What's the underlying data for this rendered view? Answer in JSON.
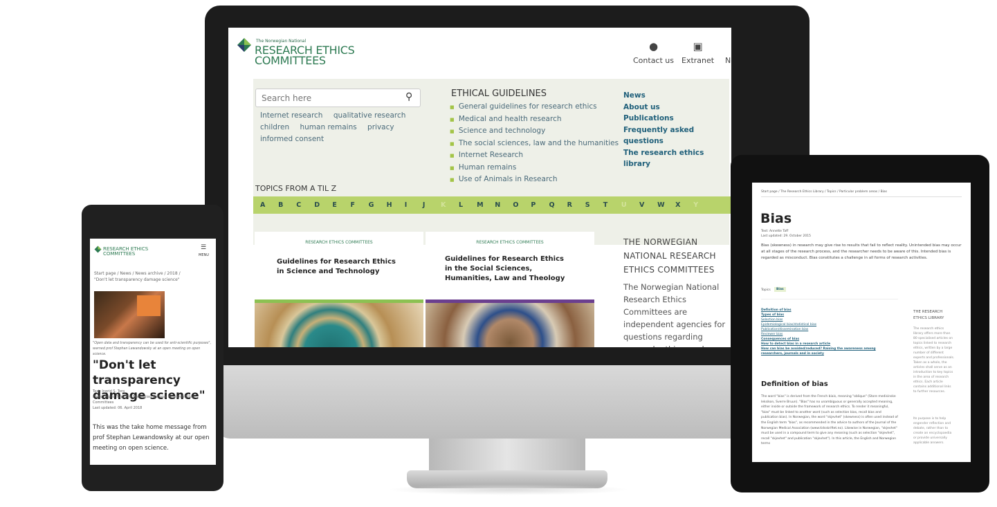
{
  "desktop": {
    "logo": {
      "small": "The Norwegian National",
      "line1": "RESEARCH ETHICS",
      "line2": "COMMITTEES"
    },
    "top_buttons": [
      {
        "label": "Contact us",
        "icon": "chat-icon"
      },
      {
        "label": "Extranet",
        "icon": "lock-icon"
      },
      {
        "label": "Norsk",
        "icon": "globe-icon"
      }
    ],
    "search": {
      "placeholder": "Search here"
    },
    "tags": [
      "Internet research",
      "qualitative research",
      "children",
      "human remains",
      "privacy",
      "informed consent"
    ],
    "ethical_guidelines": {
      "title": "ETHICAL GUIDELINES",
      "items": [
        "General guidelines for research ethics",
        "Medical and health research",
        "Science and technology",
        "The social sciences, law and the humanities",
        "Internet Research",
        "Human remains",
        "Use of Animals in Research"
      ]
    },
    "quick_links": [
      "News",
      "About us",
      "Publications",
      "Frequently asked questions",
      "The research ethics library"
    ],
    "topics": {
      "title": "TOPICS FROM A TIL Z",
      "letters": [
        "A",
        "B",
        "C",
        "D",
        "E",
        "F",
        "G",
        "H",
        "I",
        "J",
        "K",
        "L",
        "M",
        "N",
        "O",
        "P",
        "Q",
        "R",
        "S",
        "T",
        "U",
        "V",
        "W",
        "X",
        "Y"
      ]
    },
    "publications": [
      {
        "logo": "RESEARCH ETHICS COMMITTEES",
        "title_line1": "Guidelines for Research Ethics",
        "title_line2": "in Science and Technology",
        "title_line3": "",
        "bar_color": "#8cc152"
      },
      {
        "logo": "RESEARCH ETHICS COMMITTEES",
        "title_line1": "Guidelines for Research Ethics",
        "title_line2": "in the Social Sciences,",
        "title_line3": "Humanities, Law and Theology",
        "bar_color": "#6b3f8f"
      }
    ],
    "about": {
      "title": "THE NORWEGIAN NATIONAL RESEARCH ETHICS COMMITTEES",
      "body": "The Norwegian National Research Ethics Committees are independent agencies for questions regarding research ethics, and investigating misconduct, within all subject areas."
    }
  },
  "phone": {
    "logo": "RESEARCH ETHICS COMMITTEES",
    "menu_label": "MENU",
    "breadcrumb": "Start page / News / News archive / 2018 /",
    "breadcrumb_current": "\"Don't let transparency damage science\"",
    "caption": "\"Open data and transparency can be used for anti-scientific purposes\", warned prof Stephan Lewandowsky at an open meeting on open science.",
    "title": "\"Don't let transparency damage science\"",
    "meta": [
      "Text: Ingrid S. Torp",
      "Photo: Ingrid Torp/ The Norwegian National Research Ethics Committees",
      "Last updated: 06. April 2018"
    ],
    "body": "This was the take home message from prof Stephan Lewandowsky at our open meeting on open science."
  },
  "tablet": {
    "breadcrumb": "Start page  /  The Research Ethics Library  /  Topics  /  Particular problem areas  /  Bias",
    "title": "Bias",
    "meta": [
      "Text: Annette Taff",
      "Last updated: 29. October 2015"
    ],
    "intro": "Bias (skewness) in research may give rise to results that fail to reflect reality. Unintended bias may occur at all stages of the research process, and the researcher needs to be aware of this. Intended bias is regarded as misconduct. Bias constitutes a challenge in all forms of research activities.",
    "topics_label": "Topics",
    "topic_tag": "Bias",
    "toc": [
      "Definition of bias",
      "Types of bias",
      "Selection bias",
      "Epidemiological bias/statistical bias",
      "Publication/dissemination bias",
      "Reviewer bias",
      "Consequences of bias",
      "How to detect bias in a research article",
      "How can bias be avoided/reduced? Raising the awareness among researchers, journals and in society"
    ],
    "section_title": "Definition of bias",
    "section_body": "The word \"bias\" is derived from the French biais, meaning \"oblique\" (Store medisinske leksikon, Sverre Bruun). \"Bias\" has no unambiguous or generally accepted meaning, either inside or outside the framework of research ethics. To render it meaningful, \"bias\" must be linked to another word (such as selection bias, recall bias and publication bias). In Norwegian, the word \"skjevhet\" (skewness) is often used instead of the English term \"bias\", as recommended in the advice to authors of the Journal of the Norwegian Medical Association (www.tidsskriftet.no). Likewise in Norwegian, \"skjevhet\" must be used in a compound term to give any meaning (such as selection \"skjevhet\", recall \"skjevhet\" and publication \"skjevhet\"). In this article, the English and Norwegian terms",
    "sidebar_title": "THE RESEARCH ETHICS LIBRARY",
    "sidebar_body": "The research ethics library offers more than 80 specialised articles on topics linked to research ethics, written by a large number of different experts and professionals. Taken as a whole, the articles shall serve as an introduction to key topics in the area of research ethics. Each article contains additional links to further resources.",
    "sidebar_body2": "Its purpose is to help engender reflection and debate, rather than to create an encyclopaedia or provide universally applicable answers."
  }
}
